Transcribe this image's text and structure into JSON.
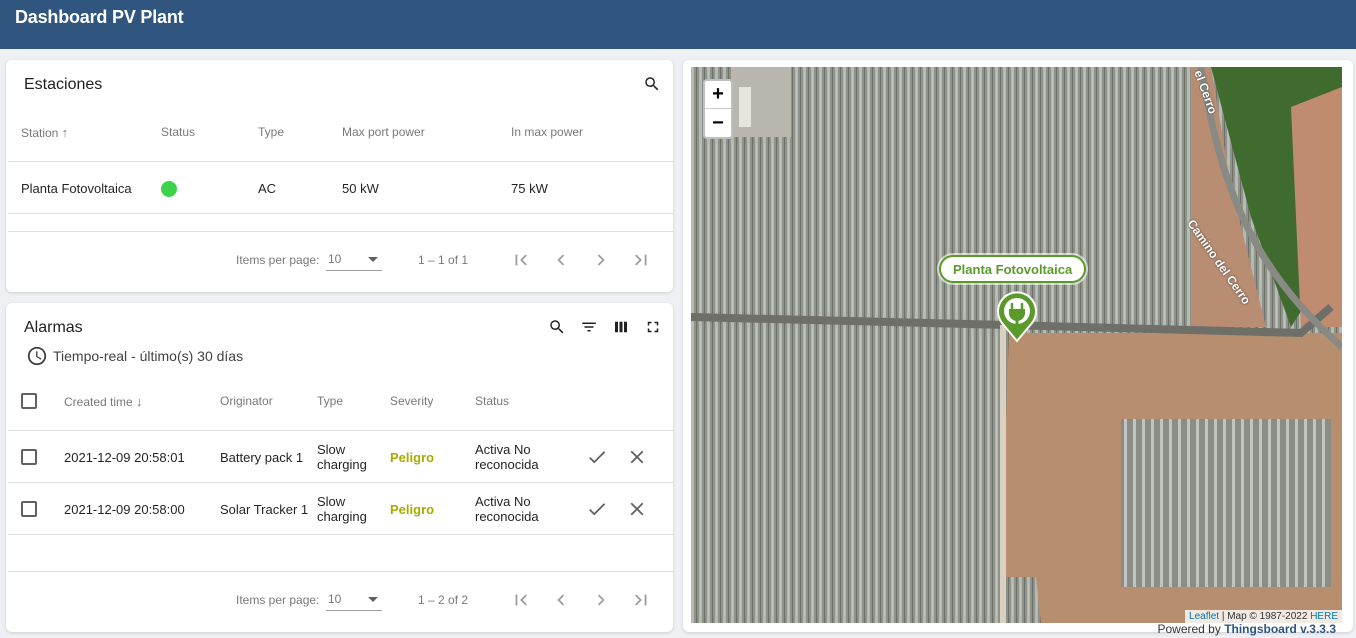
{
  "header": {
    "title": "Dashboard PV Plant"
  },
  "stations": {
    "title": "Estaciones",
    "columns": [
      "Station",
      "Status",
      "Type",
      "Max port power",
      "In max power"
    ],
    "rows": [
      {
        "station": "Planta Fotovoltaica",
        "status_color": "#3ed24a",
        "type": "AC",
        "max_port_power": "50 kW",
        "in_max_power": "75 kW"
      }
    ],
    "paginator": {
      "items_label": "Items per page:",
      "page_size": "10",
      "range": "1 – 1 of 1"
    }
  },
  "alarms": {
    "title": "Alarmas",
    "timewindow": "Tiempo-real - último(s) 30 días",
    "columns": [
      "Created time",
      "Originator",
      "Type",
      "Severity",
      "Status"
    ],
    "rows": [
      {
        "created": "2021-12-09 20:58:01",
        "originator": "Battery pack 1",
        "type_line1": "Slow",
        "type_line2": "charging",
        "severity": "Peligro",
        "status_line1": "Activa No",
        "status_line2": "reconocida"
      },
      {
        "created": "2021-12-09 20:58:00",
        "originator": "Solar Tracker 1",
        "type_line1": "Slow",
        "type_line2": "charging",
        "severity": "Peligro",
        "status_line1": "Activa No",
        "status_line2": "reconocida"
      }
    ],
    "paginator": {
      "items_label": "Items per page:",
      "page_size": "10",
      "range": "1 – 2 of 2"
    }
  },
  "map": {
    "zoom_in": "+",
    "zoom_out": "−",
    "marker_label": "Planta Fotovoltaica",
    "road_label_1": "el Cerro",
    "road_label_2": "Camino del Cerro",
    "attribution_leaflet": "Leaflet",
    "attribution_map": "| Map © 1987-2022",
    "attribution_here": "HERE",
    "powered_prefix": "Powered by",
    "powered_brand": "Thingsboard v.3.3.3"
  },
  "colors": {
    "topbar": "#305680",
    "severity": "#a7ab00",
    "marker": "#5a9a2b"
  }
}
